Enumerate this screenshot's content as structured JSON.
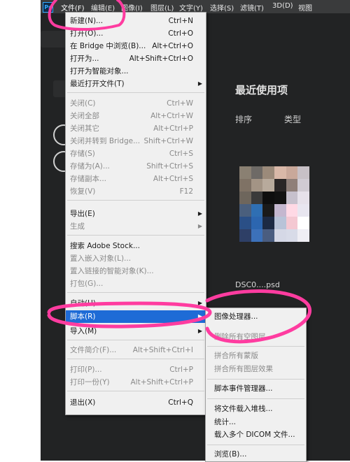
{
  "menubar": {
    "logo": "Ps",
    "items": [
      "文件(F)",
      "编辑(E)",
      "图像(I)",
      "图层(L)",
      "文字(Y)",
      "选择(S)",
      "滤镜(T)",
      "3D(D)",
      "视图"
    ]
  },
  "home": {
    "recent_title": "最近使用项",
    "sort_label": "排序",
    "type_label": "类型",
    "file_name": "DSC0....psd"
  },
  "file_menu": {
    "items": [
      {
        "label": "新建(N)...",
        "shortcut": "Ctrl+N",
        "disabled": false
      },
      {
        "label": "打开(O)...",
        "shortcut": "Ctrl+O",
        "disabled": false
      },
      {
        "label": "在 Bridge 中浏览(B)...",
        "shortcut": "Alt+Ctrl+O",
        "disabled": false
      },
      {
        "label": "打开为...",
        "shortcut": "Alt+Shift+Ctrl+O",
        "disabled": false
      },
      {
        "label": "打开为智能对象...",
        "shortcut": "",
        "disabled": false
      },
      {
        "label": "最近打开文件(T)",
        "shortcut": "",
        "disabled": false,
        "submenu": true
      },
      {
        "label": "关闭(C)",
        "shortcut": "Ctrl+W",
        "disabled": true
      },
      {
        "label": "关闭全部",
        "shortcut": "Alt+Ctrl+W",
        "disabled": true
      },
      {
        "label": "关闭其它",
        "shortcut": "Alt+Ctrl+P",
        "disabled": true
      },
      {
        "label": "关闭并转到 Bridge...",
        "shortcut": "Shift+Ctrl+W",
        "disabled": true
      },
      {
        "label": "存储(S)",
        "shortcut": "Ctrl+S",
        "disabled": true
      },
      {
        "label": "存储为(A)...",
        "shortcut": "Shift+Ctrl+S",
        "disabled": true
      },
      {
        "label": "存储副本...",
        "shortcut": "Alt+Ctrl+S",
        "disabled": true
      },
      {
        "label": "恢复(V)",
        "shortcut": "F12",
        "disabled": true
      },
      {
        "label": "导出(E)",
        "shortcut": "",
        "disabled": false,
        "submenu": true
      },
      {
        "label": "生成",
        "shortcut": "",
        "disabled": true,
        "submenu": true
      },
      {
        "label": "搜索 Adobe Stock...",
        "shortcut": "",
        "disabled": false
      },
      {
        "label": "置入嵌入对象(L)...",
        "shortcut": "",
        "disabled": true
      },
      {
        "label": "置入链接的智能对象(K)...",
        "shortcut": "",
        "disabled": true
      },
      {
        "label": "打包(G)...",
        "shortcut": "",
        "disabled": true
      },
      {
        "label": "自动(U)",
        "shortcut": "",
        "disabled": false,
        "submenu": true
      },
      {
        "label": "脚本(R)",
        "shortcut": "",
        "disabled": false,
        "submenu": true
      },
      {
        "label": "导入(M)",
        "shortcut": "",
        "disabled": false,
        "submenu": true
      },
      {
        "label": "文件简介(F)...",
        "shortcut": "Alt+Shift+Ctrl+I",
        "disabled": true
      },
      {
        "label": "打印(P)...",
        "shortcut": "Ctrl+P",
        "disabled": true
      },
      {
        "label": "打印一份(Y)",
        "shortcut": "Alt+Shift+Ctrl+P",
        "disabled": true
      },
      {
        "label": "退出(X)",
        "shortcut": "Ctrl+Q",
        "disabled": false
      }
    ]
  },
  "script_menu": {
    "items": [
      {
        "label": "图像处理器...",
        "disabled": false
      },
      {
        "label": "删除所有空图层",
        "disabled": true
      },
      {
        "label": "拼合所有蒙版",
        "disabled": true
      },
      {
        "label": "拼合所有图层效果",
        "disabled": true
      },
      {
        "label": "脚本事件管理器...",
        "disabled": false
      },
      {
        "label": "将文件载入堆栈...",
        "disabled": false
      },
      {
        "label": "统计...",
        "disabled": false
      },
      {
        "label": "载入多个 DICOM 文件...",
        "disabled": false
      },
      {
        "label": "浏览(B)...",
        "disabled": false
      }
    ]
  },
  "colors": {
    "highlight": "#1e6bd6",
    "annotation": "#ff3ca0",
    "menu_bg": "#f0f0f0",
    "app_bg": "#1b1c1d"
  }
}
